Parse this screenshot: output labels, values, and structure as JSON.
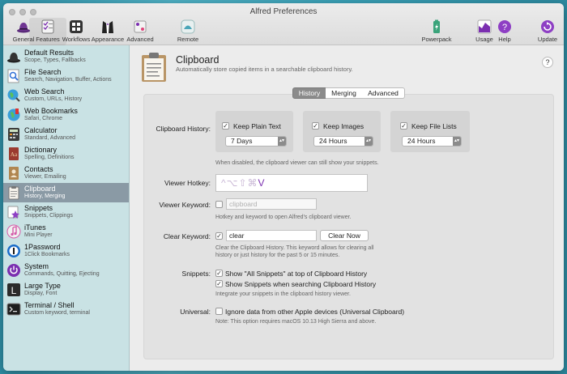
{
  "window": {
    "title": "Alfred Preferences"
  },
  "toolbar": {
    "items": [
      {
        "label": "General",
        "icon": "hat-icon"
      },
      {
        "label": "Features",
        "icon": "checklist-icon",
        "active": true
      },
      {
        "label": "Workflows",
        "icon": "workflows-icon"
      },
      {
        "label": "Appearance",
        "icon": "tuxedo-icon"
      },
      {
        "label": "Advanced",
        "icon": "advanced-icon"
      },
      {
        "label": "Remote",
        "icon": "remote-icon"
      },
      {
        "label": "Powerpack",
        "icon": "powerpack-icon"
      },
      {
        "label": "Usage",
        "icon": "usage-icon"
      },
      {
        "label": "Help",
        "icon": "help-icon"
      },
      {
        "label": "Update",
        "icon": "update-icon"
      }
    ]
  },
  "sidebar": {
    "items": [
      {
        "title": "Default Results",
        "subtitle": "Scope, Types, Fallbacks"
      },
      {
        "title": "File Search",
        "subtitle": "Search, Navigation, Buffer, Actions"
      },
      {
        "title": "Web Search",
        "subtitle": "Custom, URLs, History"
      },
      {
        "title": "Web Bookmarks",
        "subtitle": "Safari, Chrome"
      },
      {
        "title": "Calculator",
        "subtitle": "Standard, Advanced"
      },
      {
        "title": "Dictionary",
        "subtitle": "Spelling, Definitions"
      },
      {
        "title": "Contacts",
        "subtitle": "Viewer, Emailing"
      },
      {
        "title": "Clipboard",
        "subtitle": "History, Merging",
        "selected": true
      },
      {
        "title": "Snippets",
        "subtitle": "Snippets, Clippings"
      },
      {
        "title": "iTunes",
        "subtitle": "Mini Player"
      },
      {
        "title": "1Password",
        "subtitle": "1Click Bookmarks"
      },
      {
        "title": "System",
        "subtitle": "Commands, Quitting, Ejecting"
      },
      {
        "title": "Large Type",
        "subtitle": "Display, Font"
      },
      {
        "title": "Terminal / Shell",
        "subtitle": "Custom keyword, terminal"
      }
    ]
  },
  "page": {
    "title": "Clipboard",
    "subtitle": "Automatically store copied items in a searchable clipboard history.",
    "help": "?"
  },
  "tabs": [
    {
      "label": "History",
      "selected": true
    },
    {
      "label": "Merging"
    },
    {
      "label": "Advanced"
    }
  ],
  "history": {
    "label": "Clipboard History:",
    "plain_text": {
      "label": "Keep Plain Text",
      "checked": true,
      "value": "7 Days"
    },
    "images": {
      "label": "Keep Images",
      "checked": true,
      "value": "24 Hours"
    },
    "file_lists": {
      "label": "Keep File Lists",
      "checked": true,
      "value": "24 Hours"
    },
    "hint": "When disabled, the clipboard viewer can still show your snippets."
  },
  "viewer_hotkey": {
    "label": "Viewer Hotkey:",
    "dim_keys": "^⌥⇧⌘",
    "key": "V"
  },
  "viewer_keyword": {
    "label": "Viewer Keyword:",
    "checked": false,
    "placeholder": "clipboard",
    "hint": "Hotkey and keyword to open Alfred's clipboard viewer."
  },
  "clear_keyword": {
    "label": "Clear Keyword:",
    "checked": true,
    "value": "clear",
    "button": "Clear Now",
    "hint": "Clear the Clipboard History. This keyword allows for clearing all history or just history for the past 5 or 15 minutes."
  },
  "snippets": {
    "label": "Snippets:",
    "show_all": {
      "label": "Show \"All Snippets\" at top of Clipboard History",
      "checked": true
    },
    "show_search": {
      "label": "Show Snippets when searching Clipboard History",
      "checked": true
    },
    "hint": "Integrate your snippets in the clipboard history viewer."
  },
  "universal": {
    "label": "Universal:",
    "ignore": {
      "label": "Ignore data from other Apple devices (Universal Clipboard)",
      "checked": false
    },
    "hint": "Note: This option requires macOS 10.13 High Sierra and above."
  },
  "colors": {
    "accent": "#7b2fb0",
    "sidebar_bg": "#c9e2e4",
    "selected_row": "#8a9aa5"
  }
}
